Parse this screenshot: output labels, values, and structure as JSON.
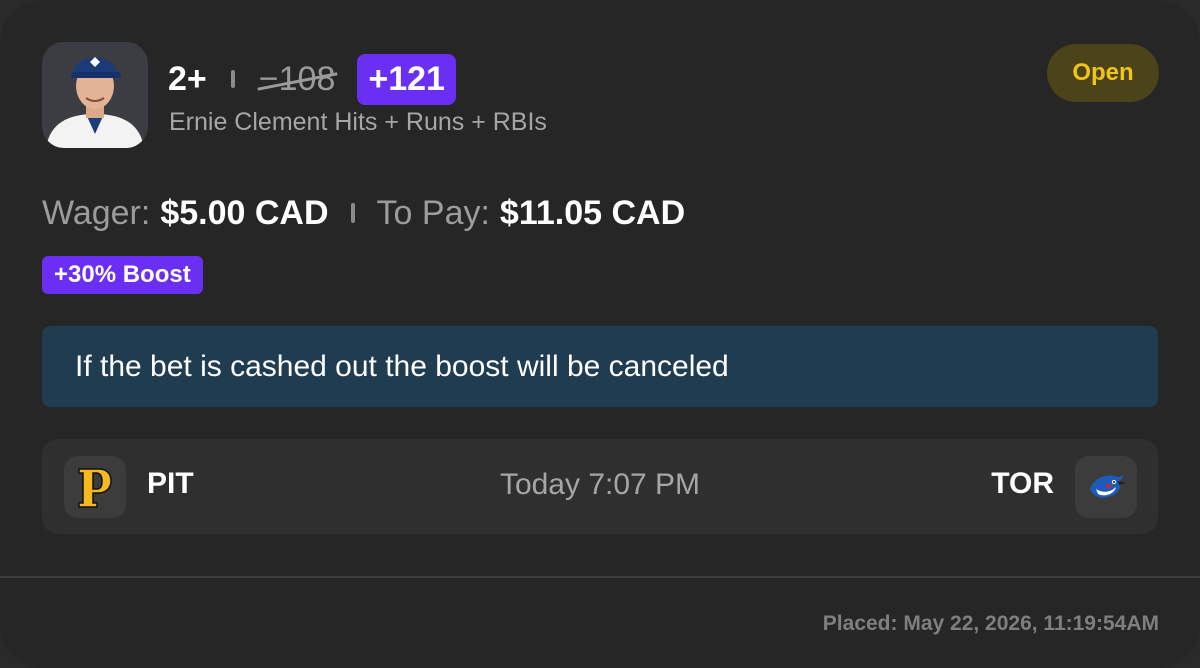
{
  "bet": {
    "line": "2+",
    "old_odds": "−108",
    "new_odds": "+121",
    "market": "Ernie Clement Hits + Runs + RBIs",
    "status": "Open"
  },
  "wager": {
    "wager_label": "Wager:",
    "wager_amount": "$5.00 CAD",
    "topay_label": "To Pay:",
    "topay_amount": "$11.05 CAD"
  },
  "boost_label": "+30% Boost",
  "notice": "If the bet is cashed out the boost will be canceled",
  "game": {
    "away": "PIT",
    "time": "Today 7:07 PM",
    "home": "TOR",
    "away_logo": "pirates-p-logo",
    "home_logo": "blue-jays-logo"
  },
  "placed": "Placed: May 22, 2026, 11:19:54AM",
  "colors": {
    "background": "#262626",
    "accent_purple": "#6a2ff2",
    "status_yellow": "#f0c418",
    "notice_bg": "#1f3c50"
  }
}
